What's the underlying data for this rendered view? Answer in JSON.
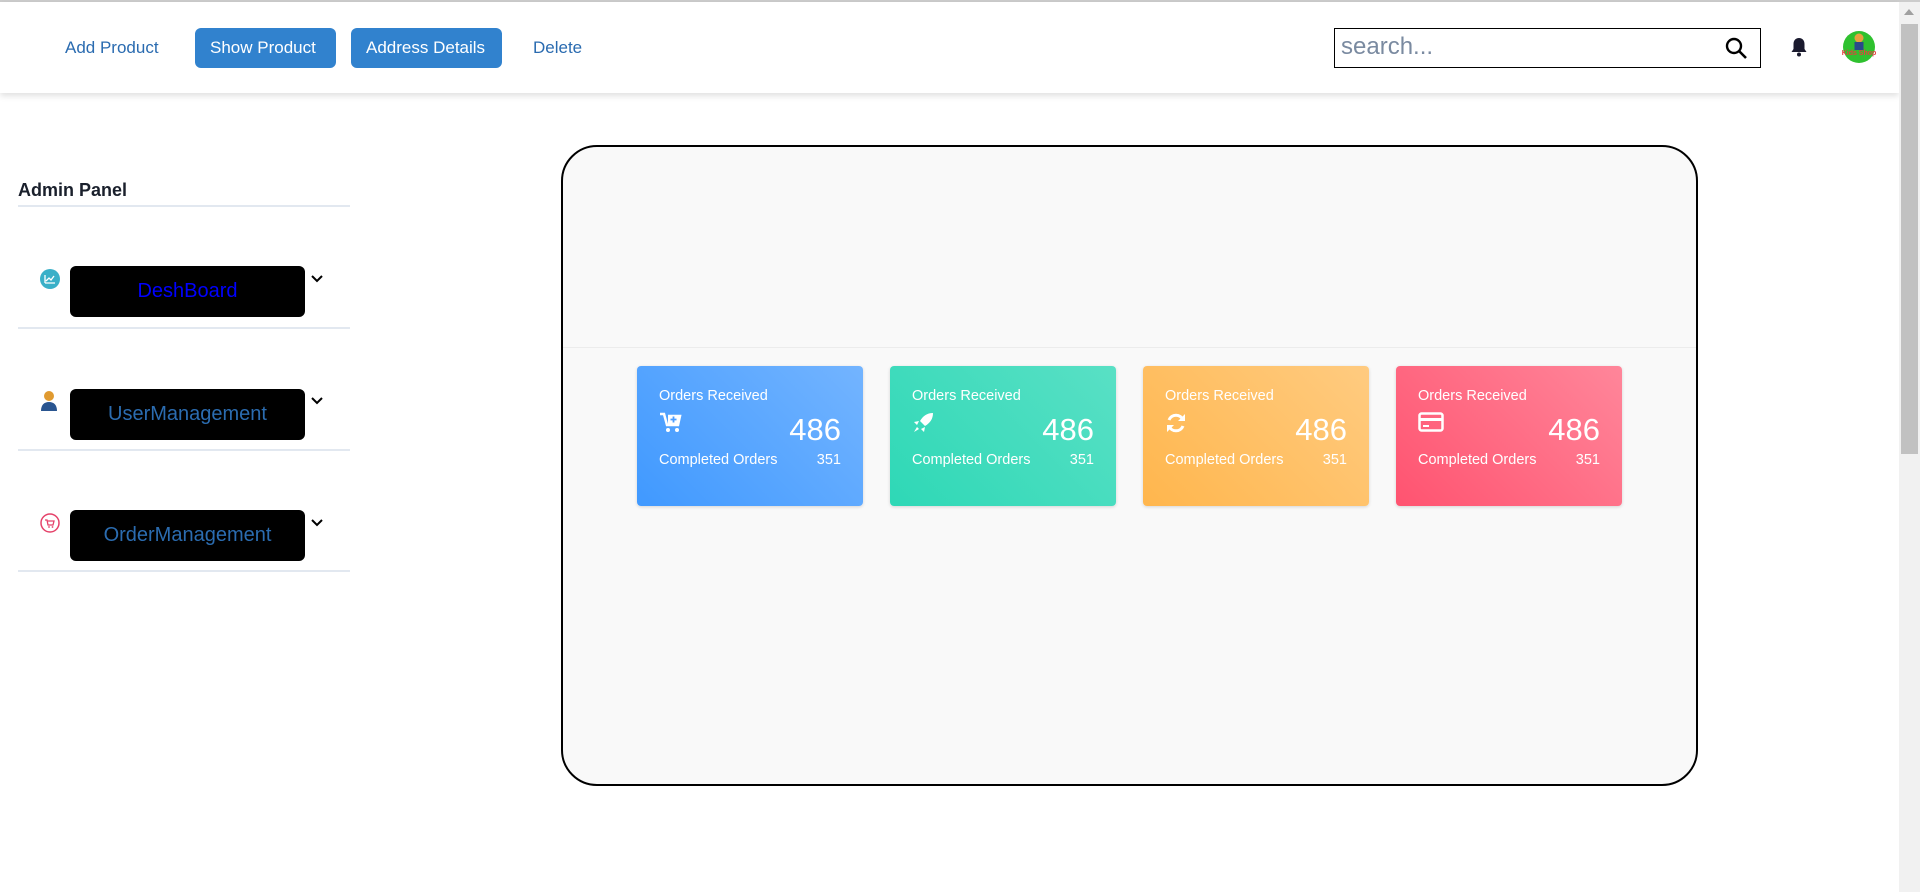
{
  "nav": {
    "links": [
      {
        "label": "Add Product",
        "active": false
      },
      {
        "label": "Show Product",
        "active": true
      },
      {
        "label": "Address Details",
        "active": true
      },
      {
        "label": "Delete",
        "active": false
      }
    ],
    "search_placeholder": "search...",
    "search_icon": "search-icon",
    "bell_icon": "bell-icon",
    "avatar_alt": "Kids Shop"
  },
  "sidebar": {
    "title": "Admin Panel",
    "items": [
      {
        "label": "DeshBoard",
        "icon": "chart-line-icon",
        "color": "#0000ff"
      },
      {
        "label": "UserManagement",
        "icon": "user-icon",
        "color": "#2b6cb0"
      },
      {
        "label": "OrderManagement",
        "icon": "cart-icon",
        "color": "#2b6cb0"
      }
    ]
  },
  "cards": [
    {
      "title": "Orders Received",
      "value": "486",
      "sub_label": "Completed Orders",
      "sub_value": "351",
      "icon": "cart-plus-icon",
      "colors": [
        "#4099ff",
        "#73b4ff"
      ]
    },
    {
      "title": "Orders Received",
      "value": "486",
      "sub_label": "Completed Orders",
      "sub_value": "351",
      "icon": "rocket-icon",
      "colors": [
        "#2ed8b6",
        "#59e0c5"
      ]
    },
    {
      "title": "Orders Received",
      "value": "486",
      "sub_label": "Completed Orders",
      "sub_value": "351",
      "icon": "refresh-icon",
      "colors": [
        "#ffb64d",
        "#ffcb80"
      ]
    },
    {
      "title": "Orders Received",
      "value": "486",
      "sub_label": "Completed Orders",
      "sub_value": "351",
      "icon": "credit-card-icon",
      "colors": [
        "#ff5370",
        "#ff869a"
      ]
    }
  ]
}
